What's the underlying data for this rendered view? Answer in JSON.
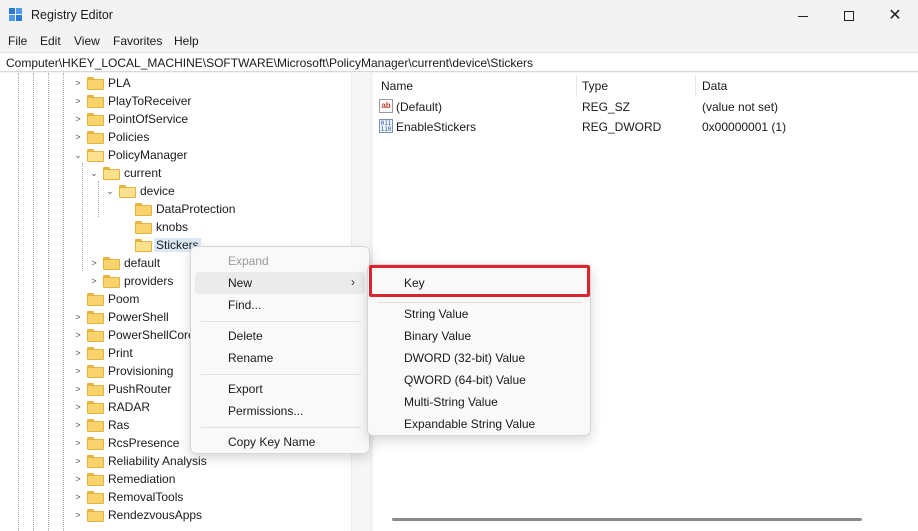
{
  "window": {
    "title": "Registry Editor"
  },
  "menubar": {
    "items": [
      "File",
      "Edit",
      "View",
      "Favorites",
      "Help"
    ]
  },
  "address": {
    "path": "Computer\\HKEY_LOCAL_MACHINE\\SOFTWARE\\Microsoft\\PolicyManager\\current\\device\\Stickers"
  },
  "tree": {
    "items": [
      {
        "label": "PLA",
        "chevron": "right"
      },
      {
        "label": "PlayToReceiver",
        "chevron": "right"
      },
      {
        "label": "PointOfService",
        "chevron": "right"
      },
      {
        "label": "Policies",
        "chevron": "right"
      },
      {
        "label": "PolicyManager",
        "chevron": "down"
      },
      {
        "label": "current",
        "chevron": "down"
      },
      {
        "label": "device",
        "chevron": "down"
      },
      {
        "label": "DataProtection",
        "chevron": "none"
      },
      {
        "label": "knobs",
        "chevron": "none"
      },
      {
        "label": "Stickers",
        "chevron": "none",
        "selected": true
      },
      {
        "label": "default",
        "chevron": "right"
      },
      {
        "label": "providers",
        "chevron": "right"
      },
      {
        "label": "Poom",
        "chevron": "none"
      },
      {
        "label": "PowerShell",
        "chevron": "right"
      },
      {
        "label": "PowerShellCore",
        "chevron": "right"
      },
      {
        "label": "Print",
        "chevron": "right"
      },
      {
        "label": "Provisioning",
        "chevron": "right"
      },
      {
        "label": "PushRouter",
        "chevron": "right"
      },
      {
        "label": "RADAR",
        "chevron": "right"
      },
      {
        "label": "Ras",
        "chevron": "right"
      },
      {
        "label": "RcsPresence",
        "chevron": "right"
      },
      {
        "label": "Reliability Analysis",
        "chevron": "right"
      },
      {
        "label": "Remediation",
        "chevron": "right"
      },
      {
        "label": "RemovalTools",
        "chevron": "right"
      },
      {
        "label": "RendezvousApps",
        "chevron": "right"
      }
    ]
  },
  "values": {
    "columns": {
      "name": "Name",
      "type": "Type",
      "data": "Data"
    },
    "rows": [
      {
        "icon": "string-value-icon",
        "name": "(Default)",
        "type": "REG_SZ",
        "data": "(value not set)"
      },
      {
        "icon": "binary-value-icon",
        "name": "EnableStickers",
        "type": "REG_DWORD",
        "data": "0x00000001 (1)"
      }
    ]
  },
  "context_menu": {
    "expand": "Expand",
    "new": "New",
    "find": "Find...",
    "delete": "Delete",
    "rename": "Rename",
    "export": "Export",
    "permissions": "Permissions...",
    "copy_key_name": "Copy Key Name"
  },
  "submenu": {
    "key": "Key",
    "string_value": "String Value",
    "binary_value": "Binary Value",
    "dword_value": "DWORD (32-bit) Value",
    "qword_value": "QWORD (64-bit) Value",
    "multi_string_value": "Multi-String Value",
    "expandable_string_value": "Expandable String Value"
  },
  "colors": {
    "highlight_border": "#d7262e",
    "selection": "#dbe9f7",
    "folder": "#f8d26a"
  }
}
